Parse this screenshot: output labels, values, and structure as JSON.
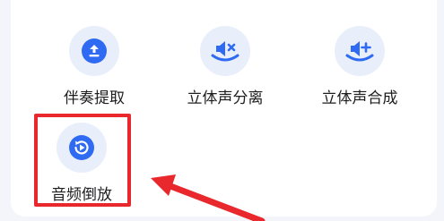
{
  "tools": [
    {
      "label": "伴奏提取",
      "icon": "upload-extract-icon"
    },
    {
      "label": "立体声分离",
      "icon": "speaker-mute-icon"
    },
    {
      "label": "立体声合成",
      "icon": "speaker-plus-icon"
    },
    {
      "label": "音频倒放",
      "icon": "reverse-play-icon"
    }
  ],
  "colors": {
    "accent": "#2f6bf2",
    "icon_bg": "#e9eefb",
    "highlight": "#e8282c",
    "page_bg": "#f3f5fb"
  }
}
